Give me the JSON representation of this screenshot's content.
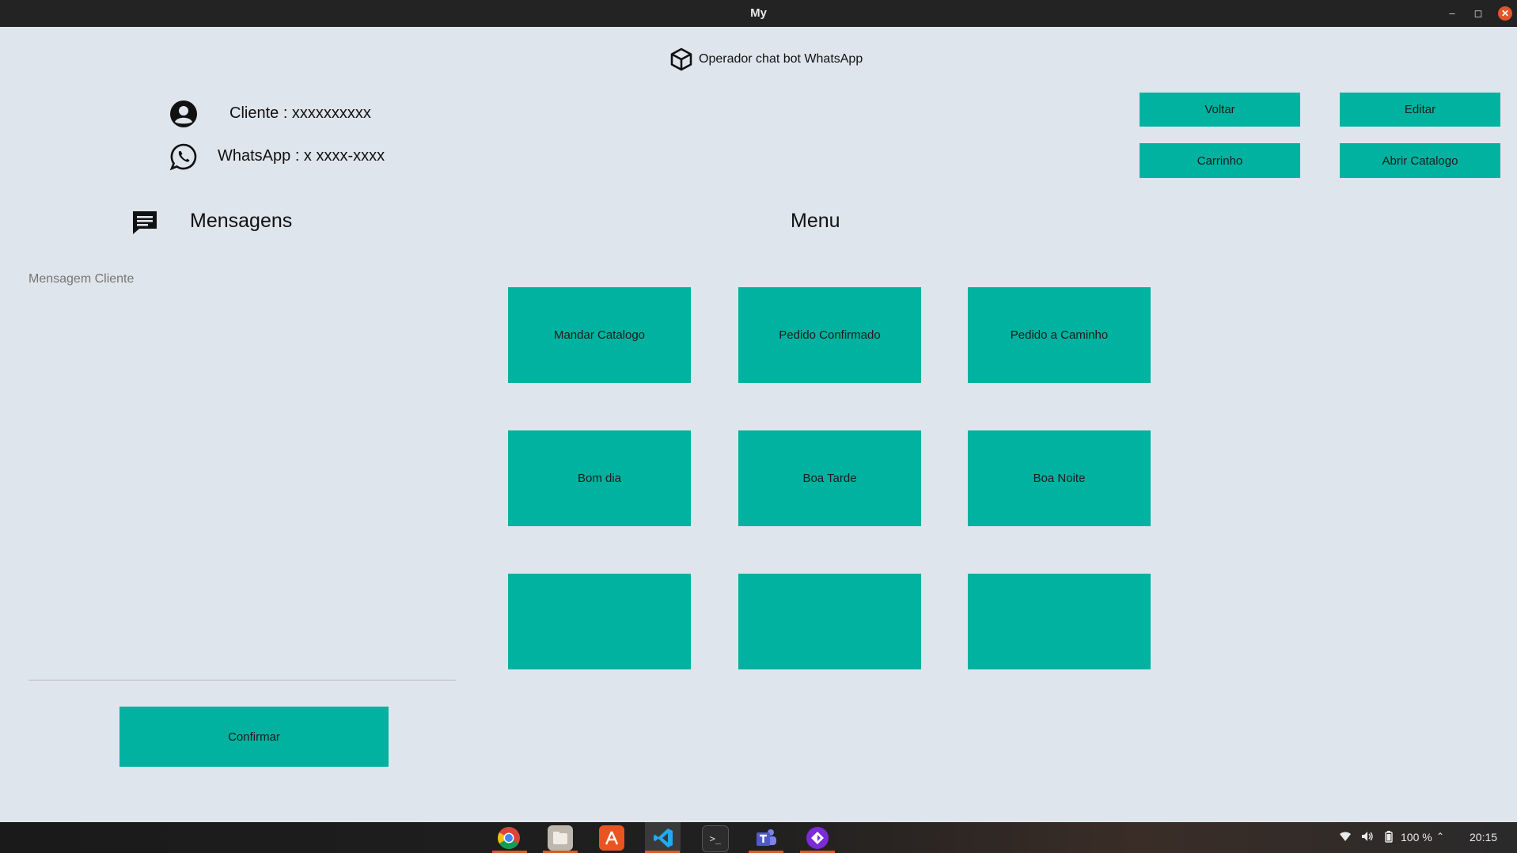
{
  "window": {
    "title": "My"
  },
  "header": {
    "app_title": "Operador chat bot WhatsApp"
  },
  "client": {
    "cliente_text": "Cliente : xxxxxxxxxx",
    "whatsapp_text": "WhatsApp : x xxxx-xxxx"
  },
  "actions": {
    "voltar": "Voltar",
    "editar": "Editar",
    "carrinho": "Carrinho",
    "abrir_catalogo": "Abrir Catalogo"
  },
  "messages": {
    "heading": "Mensagens",
    "input_placeholder": "Mensagem Cliente",
    "input_value": "",
    "confirm_label": "Confirmar"
  },
  "menu": {
    "heading": "Menu",
    "buttons": [
      "Mandar Catalogo",
      "Pedido Confirmado",
      "Pedido a Caminho",
      "Bom dia",
      "Boa Tarde",
      "Boa Noite",
      "",
      "",
      ""
    ]
  },
  "taskbar": {
    "apps": [
      "chrome-icon",
      "files-icon",
      "software-center-icon",
      "vscode-icon",
      "terminal-icon",
      "teams-icon",
      "app-purple-icon"
    ],
    "battery": "100 %",
    "clock": "20:15"
  },
  "colors": {
    "accent": "#00b29f",
    "background": "#dfe5ec",
    "titlebar": "#232323",
    "close": "#e2552b"
  }
}
